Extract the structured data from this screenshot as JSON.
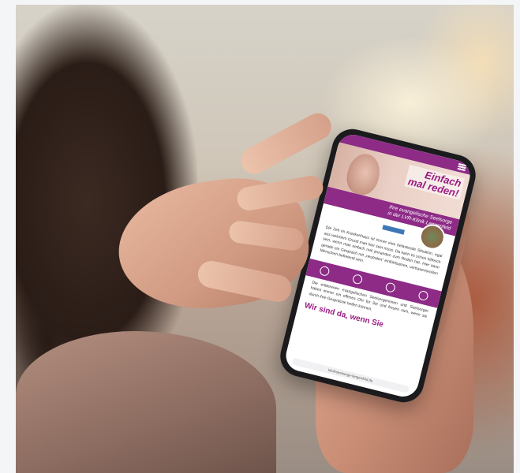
{
  "phone_screen": {
    "hero_title_line1": "Einfach",
    "hero_title_line2": "mal reden!",
    "banner_line1": "Ihre evangelische Seelsorge",
    "banner_line2": "in der LVR-Klinik Langenfeld",
    "paragraph1": "Die Zeit im Krankenhaus ist immer eine belastende Situation, egal aus welchem Grund man hier sein muss. Da kann es schon hilfreich sein, wenn man einfach mal jemanden zum Reden hat. Hier kann gerade ein Gespräch mit „neutralen“ einfühlsamen, vertrauensvollen Menschen befreiend sein.",
    "paragraph2": "Die erfahrenen evangelischen Seelsorgerinnen und Seelsorger haben immer ein offenes Ohr für Sie und freuen sich, wenn sie durch ihre Gespräche helfen können.",
    "headline": "Wir sind da, wenn Sie",
    "url": "klinikseelsorge-langenfeld.de"
  },
  "colors": {
    "brand_purple": "#8d2b86",
    "title_magenta": "#9b1b82"
  }
}
